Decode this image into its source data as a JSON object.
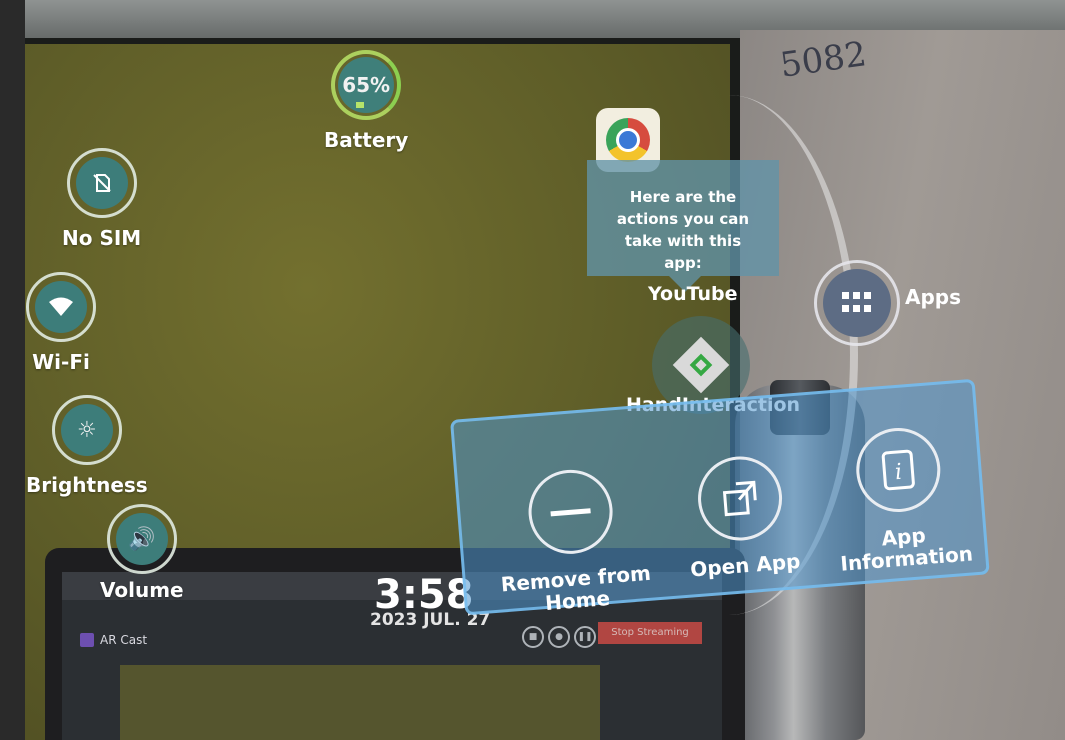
{
  "status": {
    "battery": {
      "percent_text": "65%",
      "label": "Battery",
      "level": 0.65
    },
    "sim_label": "No SIM",
    "wifi_label": "Wi-Fi",
    "brightness_label": "Brightness",
    "volume_label": "Volume"
  },
  "tooltip": {
    "text": "Here are the actions you can take with this app:"
  },
  "apps": {
    "youtube_label": "YouTube",
    "hand_label": "HandInteraction",
    "apps_label": "Apps"
  },
  "actions": {
    "remove_label": "Remove from Home",
    "open_label": "Open App",
    "info_label": "App Information"
  },
  "clock": {
    "time": "3:58",
    "date": "2023 JUL. 27"
  },
  "background": {
    "wall_note": "5082",
    "cast_app": "AR Cast",
    "stop_streaming": "Stop Streaming"
  },
  "icons": [
    "no-sim-icon",
    "wifi-icon",
    "brightness-icon",
    "volume-icon",
    "chrome-icon",
    "unity-cube-icon",
    "apps-grid-icon",
    "minus-icon",
    "open-external-icon",
    "info-icon"
  ],
  "colors": {
    "panel": "#4e96cd",
    "ring_teal": "#3d7d7a",
    "battery_ring": "#8ccf50"
  }
}
